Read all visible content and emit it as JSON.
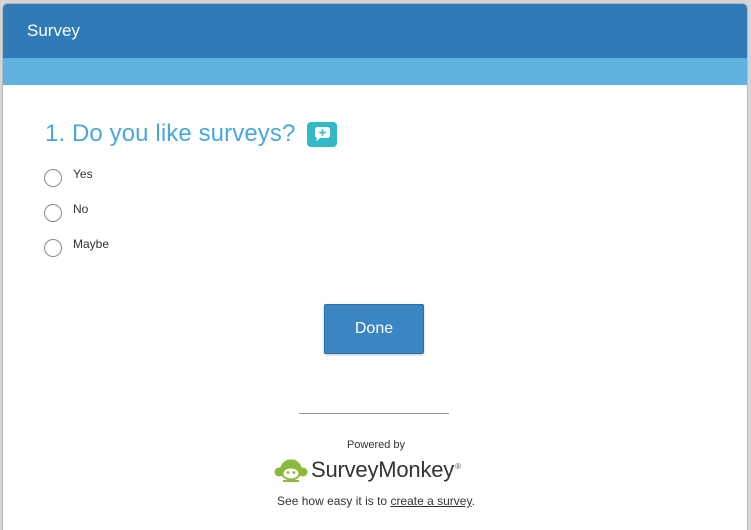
{
  "header": {
    "title": "Survey"
  },
  "question": {
    "title": "1. Do you like surveys?",
    "comment_icon": "speech-bubble-plus-icon",
    "options": [
      {
        "label": "Yes"
      },
      {
        "label": "No"
      },
      {
        "label": "Maybe"
      }
    ]
  },
  "actions": {
    "done_label": "Done"
  },
  "footer": {
    "powered_by": "Powered by",
    "brand_name": "SurveyMonkey",
    "brand_reg": "®",
    "tagline_prefix": "See how easy it is to ",
    "tagline_link": "create a survey",
    "tagline_suffix": "."
  },
  "colors": {
    "header": "#2e7bb7",
    "subbar": "#5fb1e0",
    "question_text": "#4aa7de",
    "comment_icon": "#32b9c5",
    "button": "#3a86c3",
    "brand_logo": "#8bb93a"
  }
}
